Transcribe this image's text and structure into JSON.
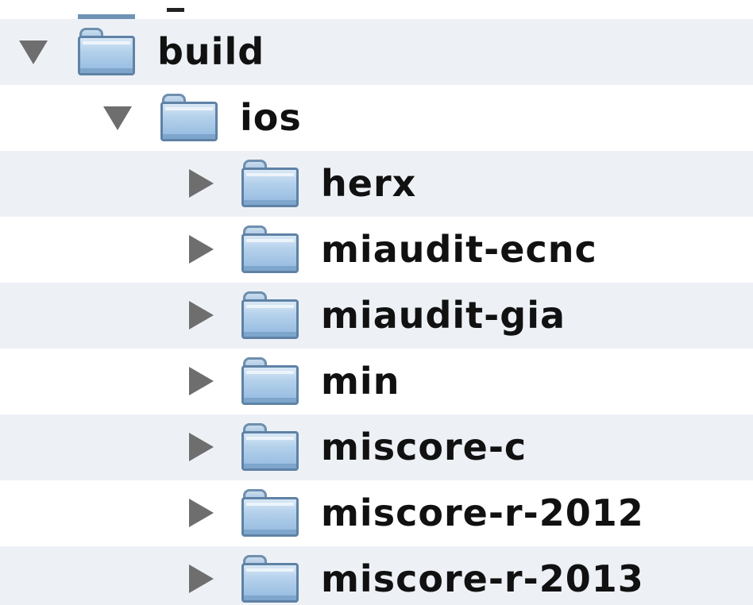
{
  "tree": {
    "items": [
      {
        "label": "build",
        "expanded": true,
        "icon": "folder-icon"
      },
      {
        "label": "ios",
        "expanded": true,
        "icon": "folder-icon"
      },
      {
        "label": "herx",
        "expanded": false,
        "icon": "folder-icon"
      },
      {
        "label": "miaudit-ecnc",
        "expanded": false,
        "icon": "folder-icon"
      },
      {
        "label": "miaudit-gia",
        "expanded": false,
        "icon": "folder-icon"
      },
      {
        "label": "min",
        "expanded": false,
        "icon": "folder-icon"
      },
      {
        "label": "miscore-c",
        "expanded": false,
        "icon": "folder-icon"
      },
      {
        "label": "miscore-r-2012",
        "expanded": false,
        "icon": "folder-icon"
      },
      {
        "label": "miscore-r-2013",
        "expanded": false,
        "icon": "folder-icon"
      }
    ]
  },
  "colors": {
    "stripe": "#edf1f6",
    "disclosure": "#6e6e6e",
    "folder_outline": "#5f82a5",
    "text": "#111111"
  }
}
